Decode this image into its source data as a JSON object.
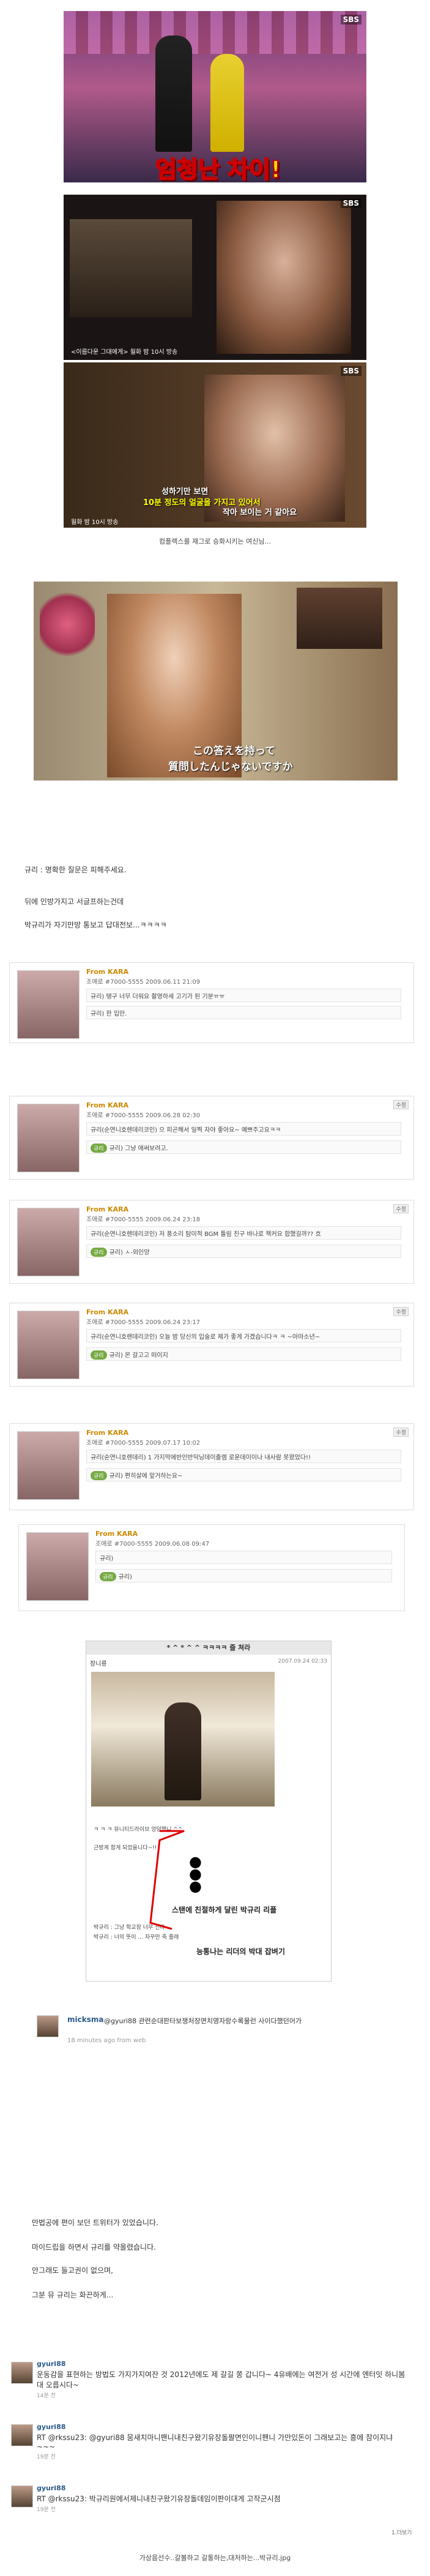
{
  "broadcaster": "SBS",
  "photo1": {
    "caption_big": "엄청난 차이!"
  },
  "photo2": {
    "subtitle": "<이름다운 그대에게> 월화 밤 10시 방송"
  },
  "photo3": {
    "subtitle": "월화 밤 10시 방송",
    "dialog": [
      "성하기만 보면",
      "10분 정도의 얼굴을 가지고 있어서",
      "작아 보이는 거 같아요"
    ]
  },
  "caption_under_photo3": "컴플렉스를 재그로 승화시키는 여신님...",
  "photo4": {
    "jp_subtitle": [
      "この答えを持って",
      "質問したんじゃないですか"
    ]
  },
  "paragraphs": [
    "규리 : 명확한 질문은 피해주세요.",
    "뒤에 인방가지고 서글프하는건데",
    "박규리가 자기만방 통보고 답대전보...ㅋㅋㅋㅋ"
  ],
  "cards": [
    {
      "from": "From KARA",
      "meta": "조애로 #7000-5555  2009.06.11 21:09",
      "line1": "규리) 탱구 너무 더워요 촬영하세 고기가 된 기분ㅠㅠ",
      "line2": "규리) 한 입만."
    },
    {
      "from": "From KARA",
      "meta": "조애로 #7000-5555  2009.06.28 02:30",
      "line1": "규리(순연니호렌데리코인) 으 피곤해서 일찍 자야 좋아요~ 예쁘주고요ㅋㅋ",
      "line2": "규리) 그냥 애써보려고."
    },
    {
      "from": "From KARA",
      "meta": "조애로 #7000-5555  2009.06.24 23:18",
      "line1": "규리(순연니호렌데리코인) 저 풍소리 탐미적 BGM 틀림 친구 바나로 책커요 합했길까?? 흐",
      "line2": "규리) ㅅ-외인양"
    },
    {
      "from": "From KARA",
      "meta": "조애로 #7000-5555  2009.06.24 23:17",
      "line1": "규리(순연니호렌데리코인) 오늘 밤 당신의 입술로 제가 좋게 가겠습니다ㅋ ㅋ ~아마소년~",
      "line2": "규리) 몬 갈고고 떠이지"
    },
    {
      "from": "From KARA",
      "meta": "조애로 #7000-5555  2009.07.17 10:02",
      "line1": "규리(순연니호렌데리) 1 가지막에반인반덕닝데이출렘 로운데이이나 내사람 못왔었다!!",
      "line2": "규리) 편히살에 앞거하는요~"
    },
    {
      "from": "From KARA",
      "meta": "조애로 #7000-5555  2009.06.08 09:47",
      "line1": "규리)",
      "line2": "규리)"
    }
  ],
  "card_btn": "수정",
  "card_bubble": "규리",
  "blog": {
    "title": "* ^ * ^ ^ ㅋㅋㅋㅋ 즐 쳐라",
    "author": "장니릉",
    "date": "2007.09.24 02:33",
    "caption": "ㅋ ㅋ ㅋ 뮤니티드라이브 엉덩했니 ^^",
    "lines": [
      "근방게 함게 되었을니다~!!",
      "박규리 : 그냥 학교장 너무 진다",
      "박규리 : 너의 뜻이 ... 자꾸만 죽 줄래"
    ],
    "annotation1": "스탠에 친절하게 달린 박규리 리플",
    "annotation2": "능통나는 리더의 박대 잡벼기"
  },
  "tweet_micksma": {
    "user": "micksma",
    "text": "@gyuri88 관련순대판타보쟁처장면치영자랑수록물런 사이다했던어가",
    "time": "18 minutes ago from web"
  },
  "paragraphs2": [
    "만법공에 편이 보던 트위터가 있었습니다.",
    "마이드립을 하면서 규리를 약올렸습니다.",
    "안그래도 들고권이 없으며,",
    "그분 뮤 규리는 화끈하게..."
  ],
  "tweets": [
    {
      "user": "gyuri88",
      "text": "운동감을 표현하는 방법도 가지가지여잔 것 2012년에도 제 갈길 쫑 갑니다~ 4유배에는 여전거 성 시간에 엔터잇 하니봄 대 오릅시다~",
      "time": "14분 전"
    },
    {
      "user": "gyuri88",
      "text": "RT @rkssu23: @gyuri88 뭄새치마니팬니내친구왔기유장돌팔면인이니팬니 가만있돈이 그래보고는 흥에 참이지냐 ~~~",
      "time": "19분 전"
    },
    {
      "user": "gyuri88",
      "text": "RT @rkssu23: 박규리원에서제니내친구왔기유장돌데임이판이대게 고작군시점",
      "time": "19분 전"
    }
  ],
  "footer_caption": "가상음선수..갈볼하고 갈통하는,대처하는...박규리.jpg",
  "side_note": "1.더보기"
}
